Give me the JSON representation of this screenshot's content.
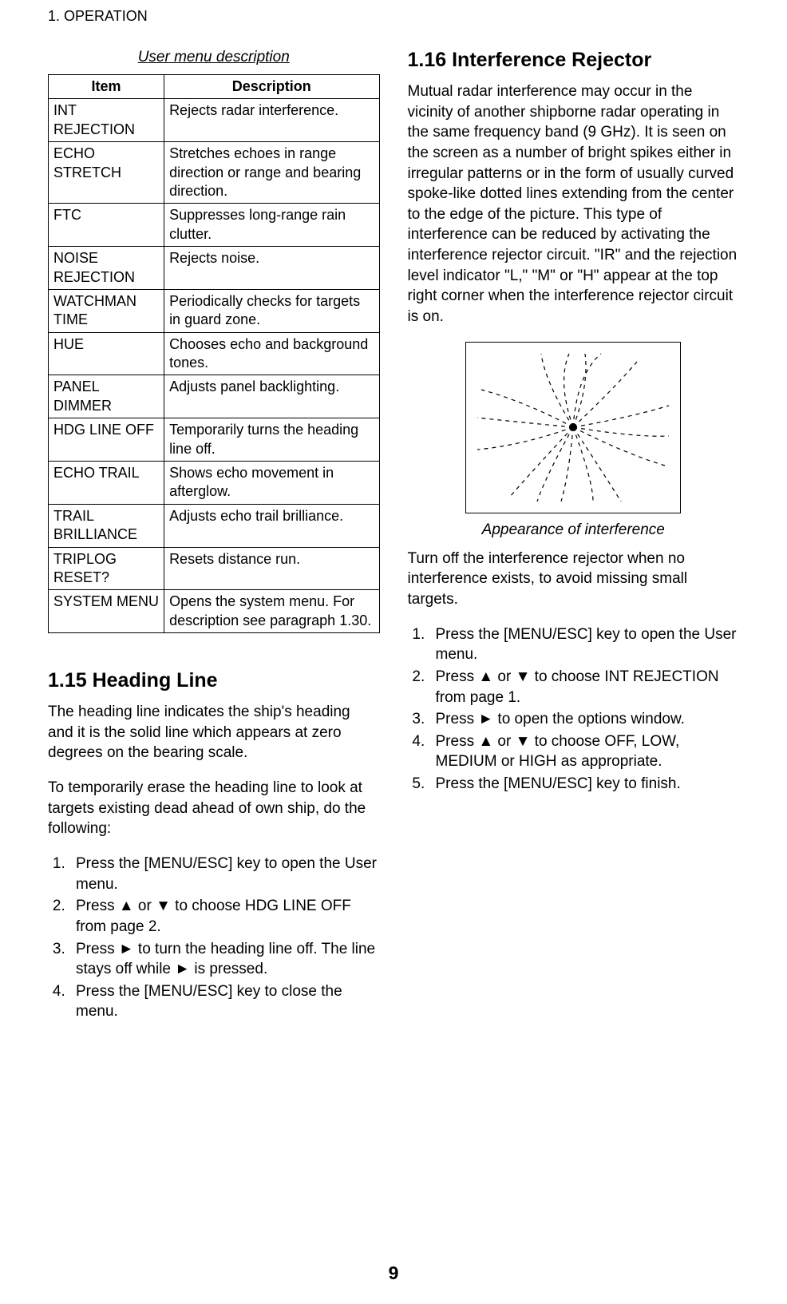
{
  "header": "1. OPERATION",
  "table_caption": "User menu description",
  "table_headers": {
    "col1": "Item",
    "col2": "Description"
  },
  "table_rows": [
    {
      "item": "INT REJECTION",
      "desc": "Rejects radar interference."
    },
    {
      "item": "ECHO STRETCH",
      "desc": "Stretches echoes in range direction or range and bearing direction."
    },
    {
      "item": "FTC",
      "desc": "Suppresses long-range rain clutter."
    },
    {
      "item": "NOISE REJECTION",
      "desc": "Rejects noise."
    },
    {
      "item": "WATCHMAN TIME",
      "desc": "Periodically checks for targets in guard zone."
    },
    {
      "item": "HUE",
      "desc": "Chooses echo and background tones."
    },
    {
      "item": "PANEL DIMMER",
      "desc": "Adjusts panel backlighting."
    },
    {
      "item": "HDG LINE OFF",
      "desc": "Temporarily turns the heading line off."
    },
    {
      "item": "ECHO TRAIL",
      "desc": "Shows echo movement in afterglow."
    },
    {
      "item": "TRAIL BRILLIANCE",
      "desc": "Adjusts echo trail brilliance."
    },
    {
      "item": "TRIPLOG RESET?",
      "desc": "Resets distance run."
    },
    {
      "item": "SYSTEM MENU",
      "desc": "Opens the system menu. For description see paragraph 1.30."
    }
  ],
  "section_115": {
    "heading": "1.15 Heading Line",
    "para1": "The heading line indicates the ship's heading and it is the solid line which appears at zero degrees on the bearing scale.",
    "para2": "To temporarily erase the heading line to look at targets existing dead ahead of own ship, do the following:",
    "steps": [
      "Press the [MENU/ESC] key to open the User menu.",
      "Press ▲ or ▼ to choose HDG LINE OFF from page 2.",
      "Press ► to turn the heading line off. The line stays off while ► is pressed.",
      "Press the [MENU/ESC] key to close the menu."
    ]
  },
  "section_116": {
    "heading": "1.16 Interference Rejector",
    "para1": "Mutual radar interference may occur in the vicinity of another shipborne radar operating in the same frequency band (9 GHz). It is seen on the screen as a number of bright spikes either in irregular patterns or in the form of usually curved spoke-like dotted lines extending from the center to the edge of the picture. This type of interference can be reduced by activating the interference rejector circuit. \"IR\" and the rejection level indicator \"L,\" \"M\" or \"H\" appear at the top right corner when the interference rejector circuit is on.",
    "figure_caption": "Appearance of interference",
    "para2": "Turn off the interference rejector when no interference exists, to avoid missing small targets.",
    "steps": [
      "Press the [MENU/ESC] key to open the User menu.",
      "Press ▲ or ▼ to choose INT REJECTION from page 1.",
      "Press ► to open the options window.",
      "Press ▲ or ▼ to choose OFF, LOW, MEDIUM or HIGH as appropriate.",
      "Press the [MENU/ESC] key to finish."
    ]
  },
  "page_number": "9"
}
